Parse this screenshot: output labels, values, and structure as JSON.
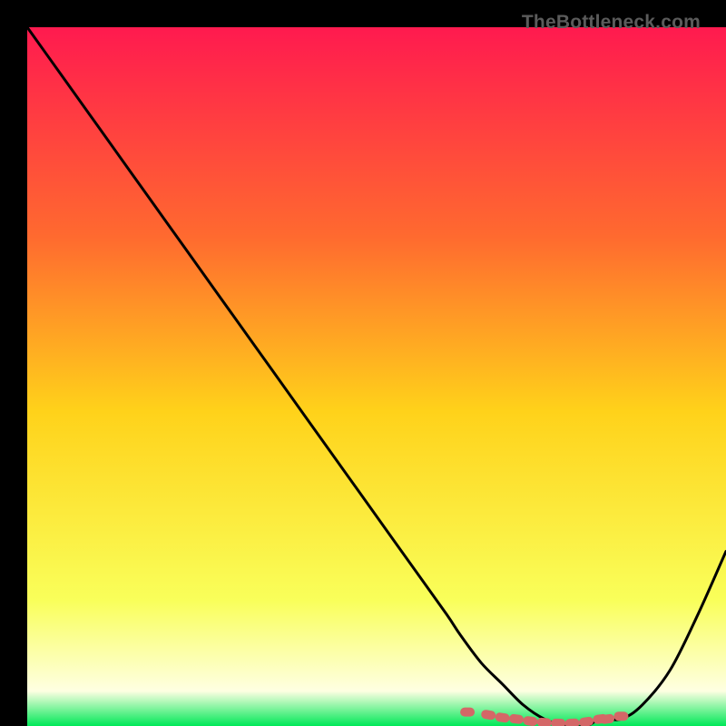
{
  "watermark": "TheBottleneck.com",
  "colors": {
    "gradient_top": "#ff1a4f",
    "gradient_mid_upper": "#ff6a2f",
    "gradient_mid": "#ffd21a",
    "gradient_lower": "#f9ff5a",
    "gradient_bottom_pale": "#feffe2",
    "gradient_bottom": "#00e858",
    "curve": "#000000",
    "marker": "#d46767",
    "frame": "#000000"
  },
  "chart_data": {
    "type": "line",
    "title": "",
    "xlabel": "",
    "ylabel": "",
    "xlim": [
      0,
      100
    ],
    "ylim": [
      0,
      100
    ],
    "series": [
      {
        "name": "bottleneck-curve",
        "x": [
          0,
          5,
          10,
          15,
          20,
          25,
          30,
          35,
          40,
          45,
          50,
          55,
          60,
          62,
          65,
          68,
          71,
          74,
          77,
          80,
          82,
          85,
          88,
          92,
          96,
          100
        ],
        "y": [
          100,
          93,
          86,
          79,
          72,
          65,
          58,
          51,
          44,
          37,
          30,
          23,
          16,
          13,
          9,
          6,
          3,
          1,
          0,
          0,
          1,
          1,
          3,
          8,
          16,
          25
        ]
      }
    ],
    "markers": {
      "name": "highlight-band",
      "x": [
        63,
        66,
        68,
        70,
        72,
        74,
        76,
        78,
        80,
        82,
        83,
        85
      ],
      "y": [
        2,
        1.6,
        1.2,
        1.0,
        0.7,
        0.5,
        0.4,
        0.4,
        0.6,
        1.0,
        1.0,
        1.4
      ]
    }
  }
}
